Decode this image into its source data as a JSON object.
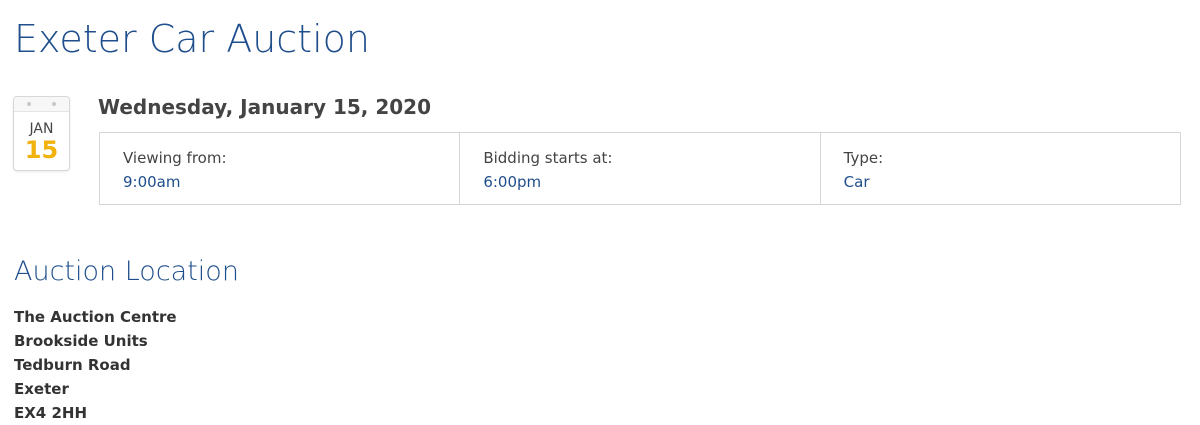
{
  "page": {
    "title": "Exeter Car Auction"
  },
  "calendar": {
    "month": "JAN",
    "day": "15"
  },
  "event": {
    "date_heading": "Wednesday, January 15, 2020",
    "details": [
      {
        "label": "Viewing from:",
        "value": "9:00am"
      },
      {
        "label": "Bidding starts at:",
        "value": "6:00pm"
      },
      {
        "label": "Type:",
        "value": "Car"
      }
    ]
  },
  "location": {
    "heading": "Auction Location",
    "address_lines": [
      "The Auction Centre",
      "Brookside Units",
      "Tedburn Road",
      "Exeter",
      "EX4 2HH"
    ]
  },
  "colors": {
    "brand_blue": "#1f4e8c",
    "calendar_day": "#f2b20c",
    "text_dark": "#333333",
    "border": "#d6d6d6"
  },
  "icons": {
    "calendar": "calendar-icon"
  }
}
